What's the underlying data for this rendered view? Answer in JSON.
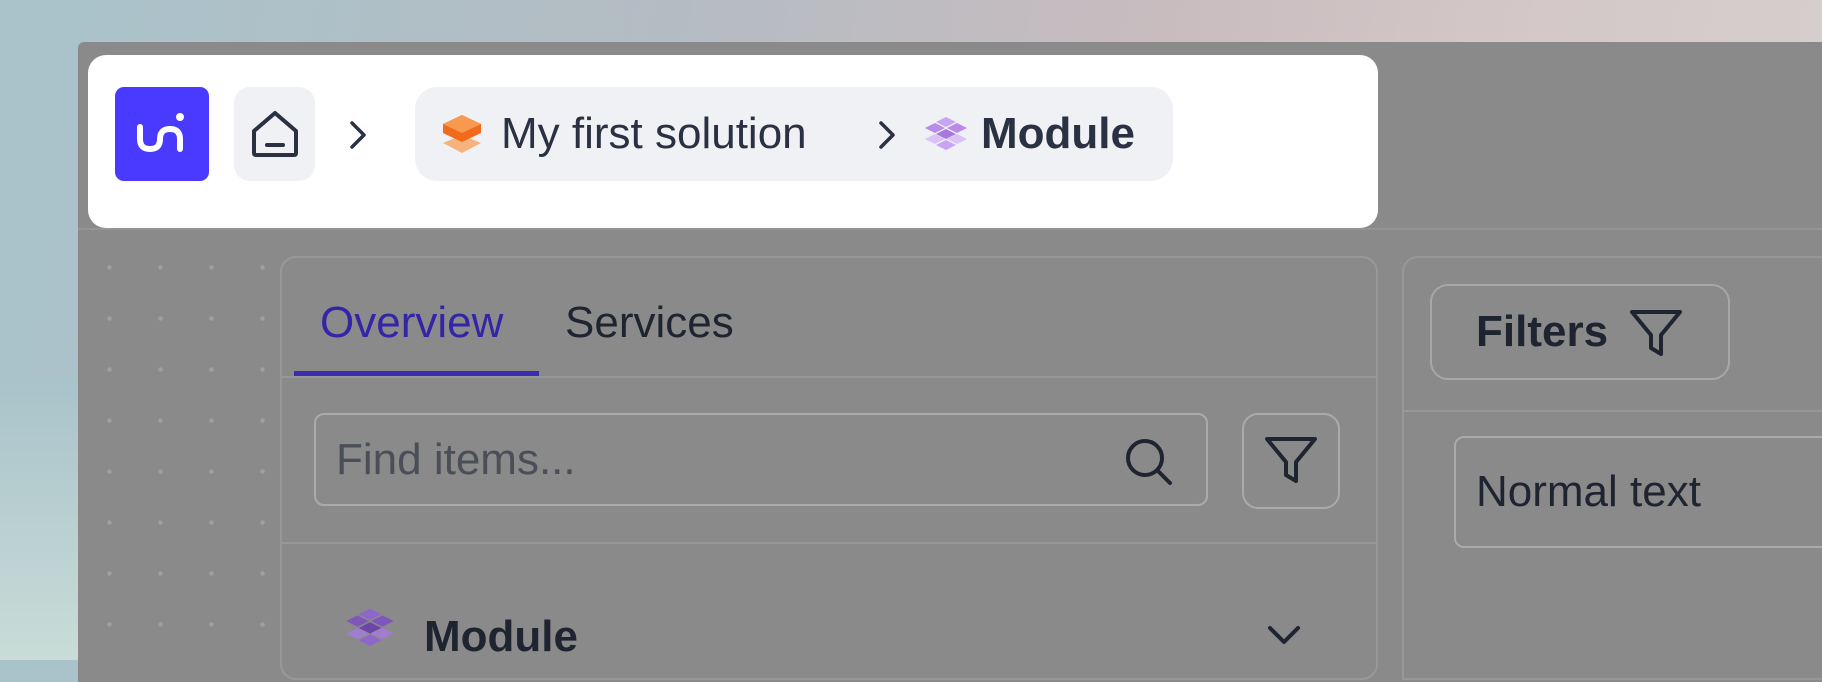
{
  "breadcrumb": {
    "logo_icon": "uni-logo",
    "home_icon": "home-icon",
    "items": [
      {
        "label": "My first solution",
        "icon": "solution-layers-icon"
      },
      {
        "label": "Module",
        "icon": "module-cubes-icon"
      }
    ]
  },
  "tabs": [
    {
      "label": "Overview",
      "active": true
    },
    {
      "label": "Services",
      "active": false
    }
  ],
  "search": {
    "placeholder": "Find items...",
    "value": ""
  },
  "list": {
    "items": [
      {
        "label": "Module",
        "icon": "module-cubes-icon",
        "expand_icon": "chevron-down-icon"
      }
    ]
  },
  "right_panel": {
    "filters_label": "Filters",
    "text_style_value": "Normal text"
  },
  "colors": {
    "brand": "#4a3aff",
    "active_tab": "#3324a8",
    "solution_icon": "#f26b1d",
    "module_icon": "#b98ae8"
  }
}
